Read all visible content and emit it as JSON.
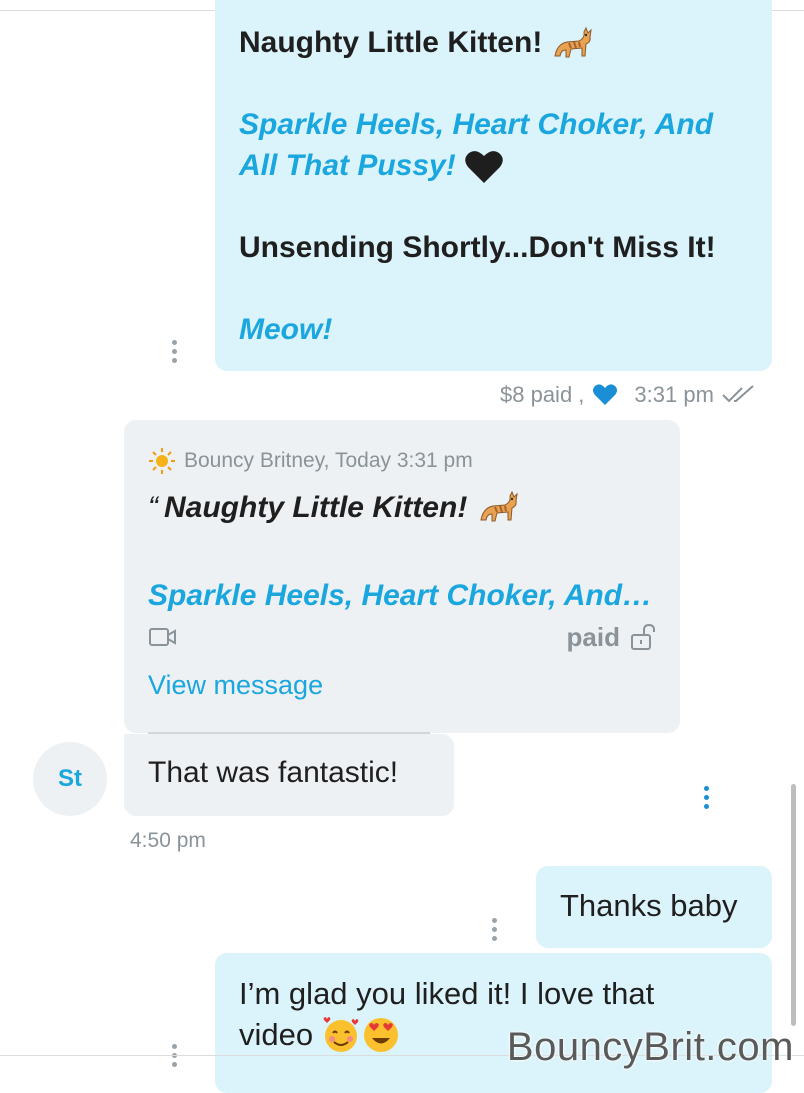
{
  "msg_out_1": {
    "line1": "Naughty Little Kitten!",
    "line2a": "Sparkle Heels, Heart Choker, And",
    "line2b": "All That Pussy!",
    "line3": "Unsending Shortly...Don't Miss It!",
    "line4": "Meow!",
    "price": "$8 paid ,",
    "time": "3:31 pm",
    "icons": [
      "cat-emoji",
      "black-heart-emoji",
      "liked-heart-icon",
      "double-check-icon"
    ]
  },
  "quoted": {
    "sender": "Bouncy Britney, Today 3:31 pm",
    "open_quote": "“",
    "title": "Naughty Little Kitten!",
    "preview": "Sparkle Heels, Heart Choker, And…",
    "paid_label": "paid",
    "view_link": "View message",
    "icons": [
      "sun-emoji",
      "video-icon",
      "unlock-icon"
    ]
  },
  "msg_in_1": {
    "text": "That was fantastic!",
    "time": "4:50 pm"
  },
  "avatar": {
    "initials": "St"
  },
  "msg_out_2": {
    "text": "Thanks baby"
  },
  "msg_out_3": {
    "line1": "I’m glad you liked it! I love that",
    "line2": "video"
  },
  "watermark": "BouncyBrit.com",
  "colors": {
    "accent": "#1aa6de",
    "bubble_out": "#dbf3fa",
    "bubble_in": "#eef1f3"
  }
}
